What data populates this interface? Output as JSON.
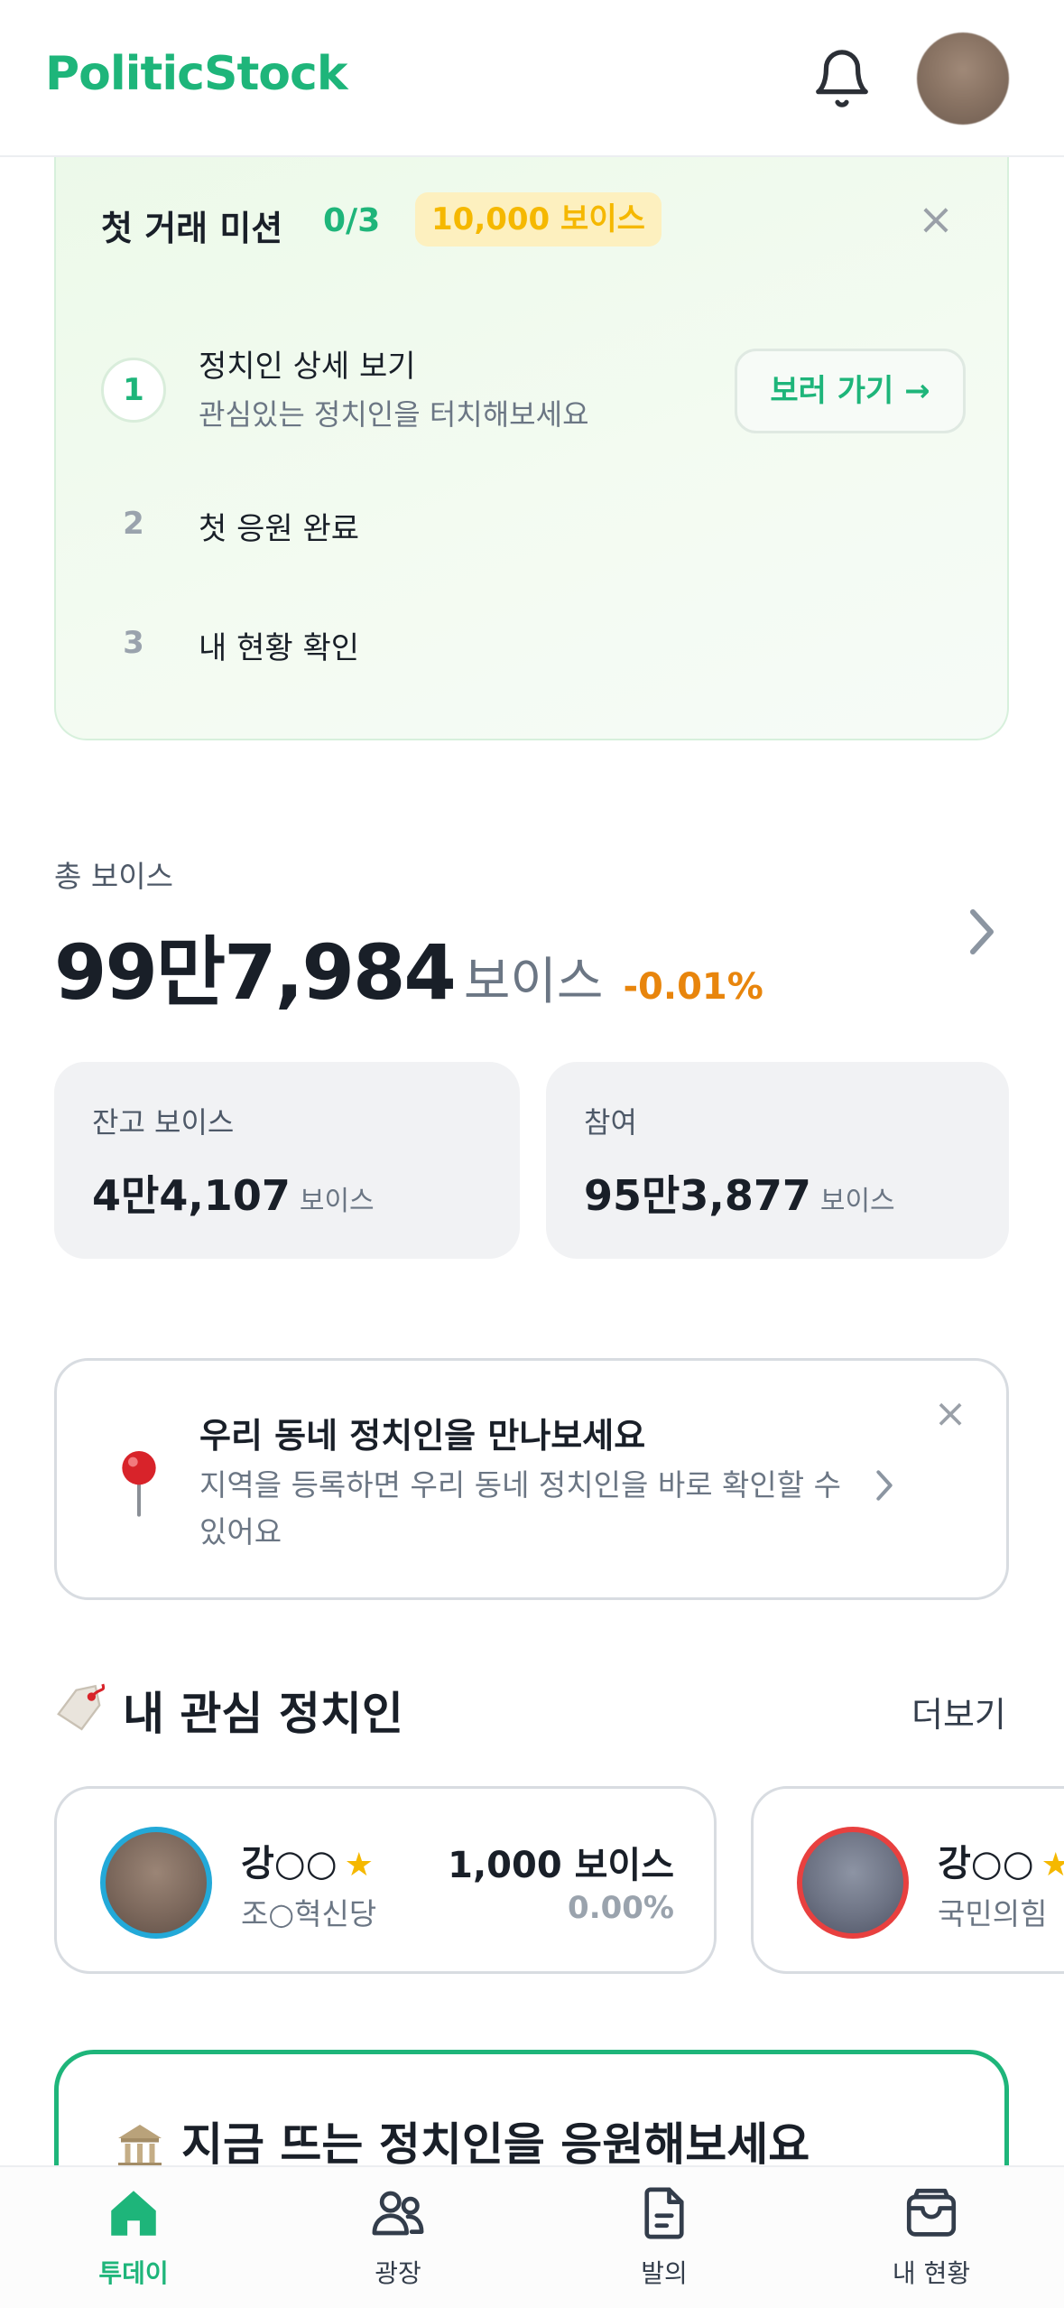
{
  "header": {
    "logo": "PoliticStock",
    "bell_icon": "bell-icon",
    "avatar": "profile-avatar"
  },
  "mission": {
    "title": "첫 거래 미션",
    "progress": "0/3",
    "reward": "10,000 보이스",
    "close_icon": "close-icon",
    "steps": [
      {
        "num": "1",
        "title": "정치인 상세 보기",
        "subtitle": "관심있는 정치인을 터치해보세요",
        "button": "보러 가기 →"
      },
      {
        "num": "2",
        "title": "첫 응원 완료"
      },
      {
        "num": "3",
        "title": "내 현황 확인"
      }
    ]
  },
  "total": {
    "label": "총 보이스",
    "amount": "99만7,984",
    "unit": "보이스",
    "change": "-0.01%"
  },
  "stats": [
    {
      "label": "잔고 보이스",
      "value": "4만4,107",
      "unit": "보이스"
    },
    {
      "label": "참여",
      "value": "95만3,877",
      "unit": "보이스"
    }
  ],
  "local_banner": {
    "title": "우리 동네 정치인을 만나보세요",
    "subtitle": "지역을 등록하면 우리 동네 정치인을 바로 확인할 수 있어요",
    "icon": "pin-icon"
  },
  "interest": {
    "title": "내 관심 정치인",
    "more": "더보기",
    "politicians": [
      {
        "name": "강○○",
        "party": "조○혁신당",
        "amount": "1,000 보이스",
        "change": "0.00%",
        "ring_color": "#23a9d8"
      },
      {
        "name": "강○○",
        "party": "국민의힘",
        "ring_color": "#e8403f"
      }
    ]
  },
  "trending": {
    "title": "지금 뜨는 정치인을 응원해보세요",
    "icon": "building-icon"
  },
  "tabs": [
    {
      "label": "투데이",
      "icon": "home-icon",
      "active": true
    },
    {
      "label": "광장",
      "icon": "users-icon"
    },
    {
      "label": "발의",
      "icon": "document-icon"
    },
    {
      "label": "내 현황",
      "icon": "wallet-icon"
    }
  ],
  "colors": {
    "brand": "#1eb57a",
    "warning": "#e8850c",
    "reward": "#f5b800"
  }
}
